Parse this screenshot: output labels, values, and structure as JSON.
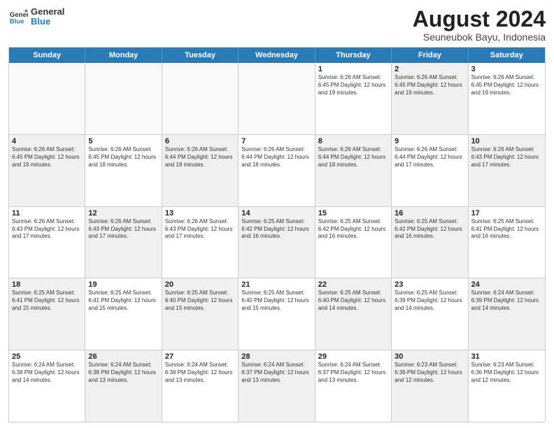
{
  "header": {
    "logo_line1": "General",
    "logo_line2": "Blue",
    "title": "August 2024",
    "subtitle": "Seuneubok Bayu, Indonesia"
  },
  "days_of_week": [
    "Sunday",
    "Monday",
    "Tuesday",
    "Wednesday",
    "Thursday",
    "Friday",
    "Saturday"
  ],
  "weeks": [
    [
      {
        "day": "",
        "text": "",
        "empty": true
      },
      {
        "day": "",
        "text": "",
        "empty": true
      },
      {
        "day": "",
        "text": "",
        "empty": true
      },
      {
        "day": "",
        "text": "",
        "empty": true
      },
      {
        "day": "1",
        "text": "Sunrise: 6:26 AM\nSunset: 6:45 PM\nDaylight: 12 hours\nand 19 minutes.",
        "shaded": false
      },
      {
        "day": "2",
        "text": "Sunrise: 6:26 AM\nSunset: 6:45 PM\nDaylight: 12 hours\nand 19 minutes.",
        "shaded": true
      },
      {
        "day": "3",
        "text": "Sunrise: 6:26 AM\nSunset: 6:45 PM\nDaylight: 12 hours\nand 19 minutes.",
        "shaded": false
      }
    ],
    [
      {
        "day": "4",
        "text": "Sunrise: 6:26 AM\nSunset: 6:45 PM\nDaylight: 12 hours\nand 19 minutes.",
        "shaded": true
      },
      {
        "day": "5",
        "text": "Sunrise: 6:26 AM\nSunset: 6:45 PM\nDaylight: 12 hours\nand 18 minutes.",
        "shaded": false
      },
      {
        "day": "6",
        "text": "Sunrise: 6:26 AM\nSunset: 6:44 PM\nDaylight: 12 hours\nand 18 minutes.",
        "shaded": true
      },
      {
        "day": "7",
        "text": "Sunrise: 6:26 AM\nSunset: 6:44 PM\nDaylight: 12 hours\nand 18 minutes.",
        "shaded": false
      },
      {
        "day": "8",
        "text": "Sunrise: 6:26 AM\nSunset: 6:44 PM\nDaylight: 12 hours\nand 18 minutes.",
        "shaded": true
      },
      {
        "day": "9",
        "text": "Sunrise: 6:26 AM\nSunset: 6:44 PM\nDaylight: 12 hours\nand 17 minutes.",
        "shaded": false
      },
      {
        "day": "10",
        "text": "Sunrise: 6:26 AM\nSunset: 6:43 PM\nDaylight: 12 hours\nand 17 minutes.",
        "shaded": true
      }
    ],
    [
      {
        "day": "11",
        "text": "Sunrise: 6:26 AM\nSunset: 6:43 PM\nDaylight: 12 hours\nand 17 minutes.",
        "shaded": false
      },
      {
        "day": "12",
        "text": "Sunrise: 6:26 AM\nSunset: 6:43 PM\nDaylight: 12 hours\nand 17 minutes.",
        "shaded": true
      },
      {
        "day": "13",
        "text": "Sunrise: 6:26 AM\nSunset: 6:43 PM\nDaylight: 12 hours\nand 17 minutes.",
        "shaded": false
      },
      {
        "day": "14",
        "text": "Sunrise: 6:25 AM\nSunset: 6:42 PM\nDaylight: 12 hours\nand 16 minutes.",
        "shaded": true
      },
      {
        "day": "15",
        "text": "Sunrise: 6:25 AM\nSunset: 6:42 PM\nDaylight: 12 hours\nand 16 minutes.",
        "shaded": false
      },
      {
        "day": "16",
        "text": "Sunrise: 6:25 AM\nSunset: 6:42 PM\nDaylight: 12 hours\nand 16 minutes.",
        "shaded": true
      },
      {
        "day": "17",
        "text": "Sunrise: 6:25 AM\nSunset: 6:41 PM\nDaylight: 12 hours\nand 16 minutes.",
        "shaded": false
      }
    ],
    [
      {
        "day": "18",
        "text": "Sunrise: 6:25 AM\nSunset: 6:41 PM\nDaylight: 12 hours\nand 15 minutes.",
        "shaded": true
      },
      {
        "day": "19",
        "text": "Sunrise: 6:25 AM\nSunset: 6:41 PM\nDaylight: 12 hours\nand 15 minutes.",
        "shaded": false
      },
      {
        "day": "20",
        "text": "Sunrise: 6:25 AM\nSunset: 6:40 PM\nDaylight: 12 hours\nand 15 minutes.",
        "shaded": true
      },
      {
        "day": "21",
        "text": "Sunrise: 6:25 AM\nSunset: 6:40 PM\nDaylight: 12 hours\nand 15 minutes.",
        "shaded": false
      },
      {
        "day": "22",
        "text": "Sunrise: 6:25 AM\nSunset: 6:40 PM\nDaylight: 12 hours\nand 14 minutes.",
        "shaded": true
      },
      {
        "day": "23",
        "text": "Sunrise: 6:25 AM\nSunset: 6:39 PM\nDaylight: 12 hours\nand 14 minutes.",
        "shaded": false
      },
      {
        "day": "24",
        "text": "Sunrise: 6:24 AM\nSunset: 6:39 PM\nDaylight: 12 hours\nand 14 minutes.",
        "shaded": true
      }
    ],
    [
      {
        "day": "25",
        "text": "Sunrise: 6:24 AM\nSunset: 6:38 PM\nDaylight: 12 hours\nand 14 minutes.",
        "shaded": false
      },
      {
        "day": "26",
        "text": "Sunrise: 6:24 AM\nSunset: 6:38 PM\nDaylight: 12 hours\nand 13 minutes.",
        "shaded": true
      },
      {
        "day": "27",
        "text": "Sunrise: 6:24 AM\nSunset: 6:38 PM\nDaylight: 12 hours\nand 13 minutes.",
        "shaded": false
      },
      {
        "day": "28",
        "text": "Sunrise: 6:24 AM\nSunset: 6:37 PM\nDaylight: 12 hours\nand 13 minutes.",
        "shaded": true
      },
      {
        "day": "29",
        "text": "Sunrise: 6:24 AM\nSunset: 6:37 PM\nDaylight: 12 hours\nand 13 minutes.",
        "shaded": false
      },
      {
        "day": "30",
        "text": "Sunrise: 6:23 AM\nSunset: 6:36 PM\nDaylight: 12 hours\nand 12 minutes.",
        "shaded": true
      },
      {
        "day": "31",
        "text": "Sunrise: 6:23 AM\nSunset: 6:36 PM\nDaylight: 12 hours\nand 12 minutes.",
        "shaded": false
      }
    ]
  ]
}
